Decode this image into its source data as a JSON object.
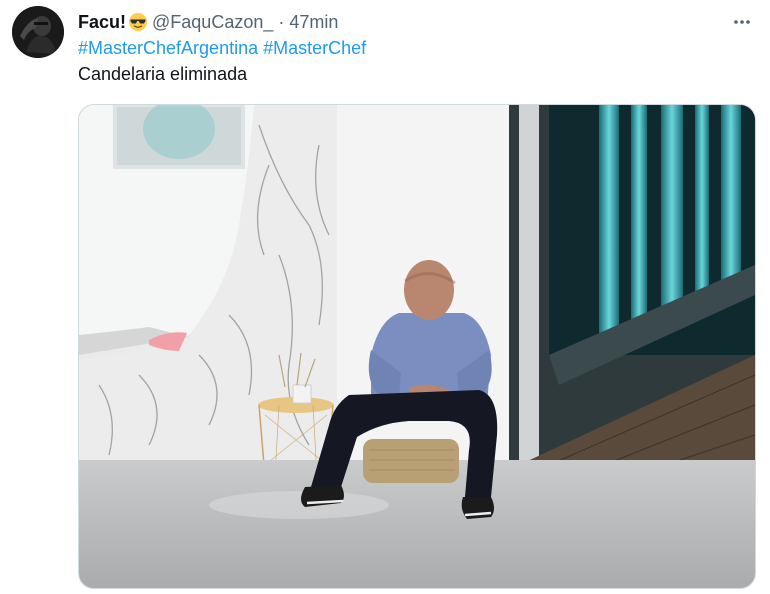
{
  "tweet": {
    "display_name": "Facu!",
    "emoji_icon": "sunglasses-emoji",
    "handle": "@FaquCazon_",
    "separator": "·",
    "time": "47min",
    "more_icon": "more-horizontal-icon",
    "hashtags": [
      "#MasterChefArgentina",
      "#MasterChef"
    ],
    "text": "Candelaria eliminada",
    "media_icon": "photo"
  },
  "colors": {
    "link": "#1d9bf0",
    "secondary_text": "#536471",
    "primary_text": "#0f1419"
  }
}
